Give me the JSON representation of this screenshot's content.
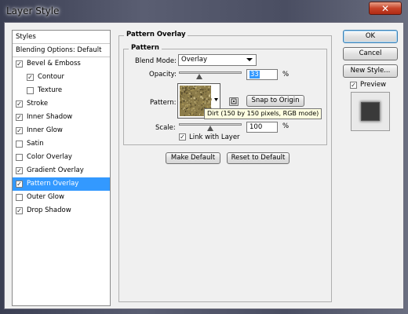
{
  "window": {
    "title": "Layer Style",
    "close_glyph": "✕"
  },
  "styles_panel": {
    "header": "Styles",
    "blending": "Blending Options: Default",
    "items": [
      {
        "label": "Bevel & Emboss",
        "checked": true,
        "indent": false,
        "selected": false
      },
      {
        "label": "Contour",
        "checked": true,
        "indent": true,
        "selected": false
      },
      {
        "label": "Texture",
        "checked": false,
        "indent": true,
        "selected": false
      },
      {
        "label": "Stroke",
        "checked": true,
        "indent": false,
        "selected": false
      },
      {
        "label": "Inner Shadow",
        "checked": true,
        "indent": false,
        "selected": false
      },
      {
        "label": "Inner Glow",
        "checked": true,
        "indent": false,
        "selected": false
      },
      {
        "label": "Satin",
        "checked": false,
        "indent": false,
        "selected": false
      },
      {
        "label": "Color Overlay",
        "checked": false,
        "indent": false,
        "selected": false
      },
      {
        "label": "Gradient Overlay",
        "checked": true,
        "indent": false,
        "selected": false
      },
      {
        "label": "Pattern Overlay",
        "checked": true,
        "indent": false,
        "selected": true
      },
      {
        "label": "Outer Glow",
        "checked": false,
        "indent": false,
        "selected": false
      },
      {
        "label": "Drop Shadow",
        "checked": true,
        "indent": false,
        "selected": false
      }
    ]
  },
  "pattern_overlay": {
    "group_title": "Pattern Overlay",
    "subgroup_title": "Pattern",
    "blend_mode_label": "Blend Mode:",
    "blend_mode_value": "Overlay",
    "opacity_label": "Opacity:",
    "opacity_value": "33",
    "opacity_fraction": 0.33,
    "percent": "%",
    "pattern_label": "Pattern:",
    "snap_to_origin": "Snap to Origin",
    "tooltip": "Dirt (150 by 150 pixels, RGB mode)",
    "scale_label": "Scale:",
    "scale_value": "100",
    "scale_fraction": 0.5,
    "link_with_layer": "Link with Layer",
    "link_checked": true,
    "make_default": "Make Default",
    "reset_to_default": "Reset to Default"
  },
  "right_buttons": {
    "ok": "OK",
    "cancel": "Cancel",
    "new_style": "New Style...",
    "preview": "Preview",
    "preview_checked": true
  },
  "icons": {
    "check": "✓",
    "dropdown": "▾"
  },
  "colors": {
    "selection": "#3399ff",
    "tooltip_bg": "#ffffe1",
    "close_red": "#c8442a"
  }
}
